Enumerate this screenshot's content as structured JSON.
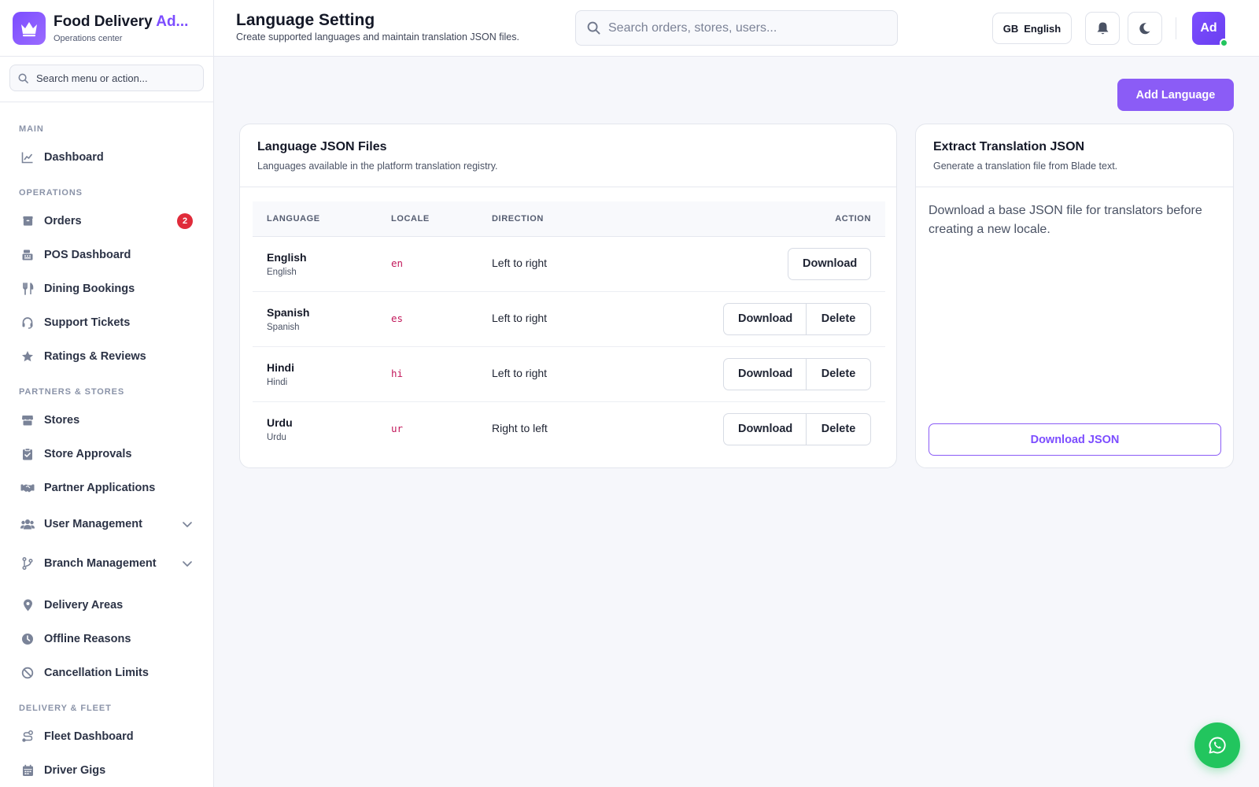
{
  "brand": {
    "title_main": "Food Delivery ",
    "title_accent": "Ad...",
    "subtitle": "Operations center",
    "logo_icon": "crown-icon",
    "accent_color": "#7c4dff"
  },
  "sidebar": {
    "search_placeholder": "Search menu or action...",
    "sections": {
      "main": "MAIN",
      "operations": "OPERATIONS",
      "partners": "PARTNERS & STORES",
      "delivery": "DELIVERY & FLEET"
    },
    "items": {
      "dashboard": "Dashboard",
      "orders": "Orders",
      "orders_badge": "2",
      "pos_dashboard": "POS Dashboard",
      "dining_bookings": "Dining Bookings",
      "support_tickets": "Support Tickets",
      "ratings_reviews": "Ratings & Reviews",
      "stores": "Stores",
      "store_approvals": "Store Approvals",
      "partner_applications": "Partner Applications",
      "user_management": "User Management",
      "branch_management": "Branch Management",
      "delivery_areas": "Delivery Areas",
      "offline_reasons": "Offline Reasons",
      "cancellation_limits": "Cancellation Limits",
      "fleet_dashboard": "Fleet Dashboard",
      "driver_gigs": "Driver Gigs"
    }
  },
  "header": {
    "title": "Language Setting",
    "subtitle": "Create supported languages and maintain translation JSON files.",
    "search_placeholder": "Search orders, stores, users...",
    "language_code": "GB",
    "language_label": "English",
    "avatar_initials": "Ad"
  },
  "actions": {
    "add_language": "Add Language"
  },
  "languages_card": {
    "title": "Language JSON Files",
    "subtitle": "Languages available in the platform translation registry.",
    "columns": {
      "language": "LANGUAGE",
      "locale": "LOCALE",
      "direction": "DIRECTION",
      "action": "ACTION"
    },
    "rows": [
      {
        "name": "English",
        "native": "English",
        "locale": "en",
        "direction": "Left to right",
        "download": "Download"
      },
      {
        "name": "Spanish",
        "native": "Spanish",
        "locale": "es",
        "direction": "Left to right",
        "download": "Download",
        "delete": "Delete"
      },
      {
        "name": "Hindi",
        "native": "Hindi",
        "locale": "hi",
        "direction": "Left to right",
        "download": "Download",
        "delete": "Delete"
      },
      {
        "name": "Urdu",
        "native": "Urdu",
        "locale": "ur",
        "direction": "Right to left",
        "download": "Download",
        "delete": "Delete"
      }
    ]
  },
  "extract_card": {
    "title": "Extract Translation JSON",
    "subtitle": "Generate a translation file from Blade text.",
    "body": "Download a base JSON file for translators before creating a new locale.",
    "button": "Download JSON"
  },
  "fab": {
    "icon": "whatsapp-icon",
    "color": "#22c55e"
  }
}
